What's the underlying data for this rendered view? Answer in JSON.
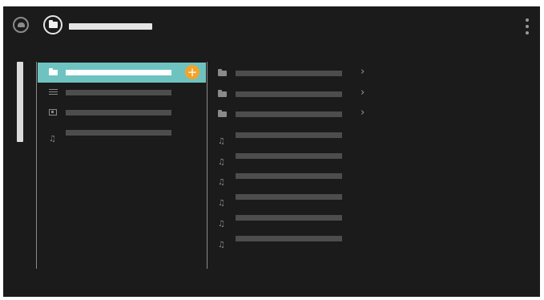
{
  "header": {
    "title": "",
    "cloud_button_icon": "cloud-icon",
    "folder_button_icon": "folder-icon",
    "menu_icon": "kebab-menu-icon"
  },
  "sidebar": {
    "items": [
      {
        "label": "",
        "icon": "folder-icon",
        "selected": true
      },
      {
        "label": "",
        "icon": "list-icon",
        "selected": false
      },
      {
        "label": "",
        "icon": "photo-icon",
        "selected": false
      },
      {
        "label": "",
        "icon": "music-icon",
        "selected": false
      }
    ],
    "add_button_label": "+"
  },
  "content": {
    "items": [
      {
        "label": "",
        "icon": "folder-icon",
        "chevron": "›"
      },
      {
        "label": "",
        "icon": "folder-icon",
        "chevron": "›"
      },
      {
        "label": "",
        "icon": "folder-icon",
        "chevron": "›"
      },
      {
        "label": "",
        "icon": "music-icon"
      },
      {
        "label": "",
        "icon": "music-icon"
      },
      {
        "label": "",
        "icon": "music-icon"
      },
      {
        "label": "",
        "icon": "music-icon"
      },
      {
        "label": "",
        "icon": "music-icon"
      },
      {
        "label": "",
        "icon": "music-icon"
      }
    ]
  },
  "colors": {
    "background": "#1b1b1b",
    "selection": "#6ec3c1",
    "accent": "#f3a32a",
    "placeholder_bar": "#4d4d4d",
    "icon": "#8a8a8a"
  }
}
